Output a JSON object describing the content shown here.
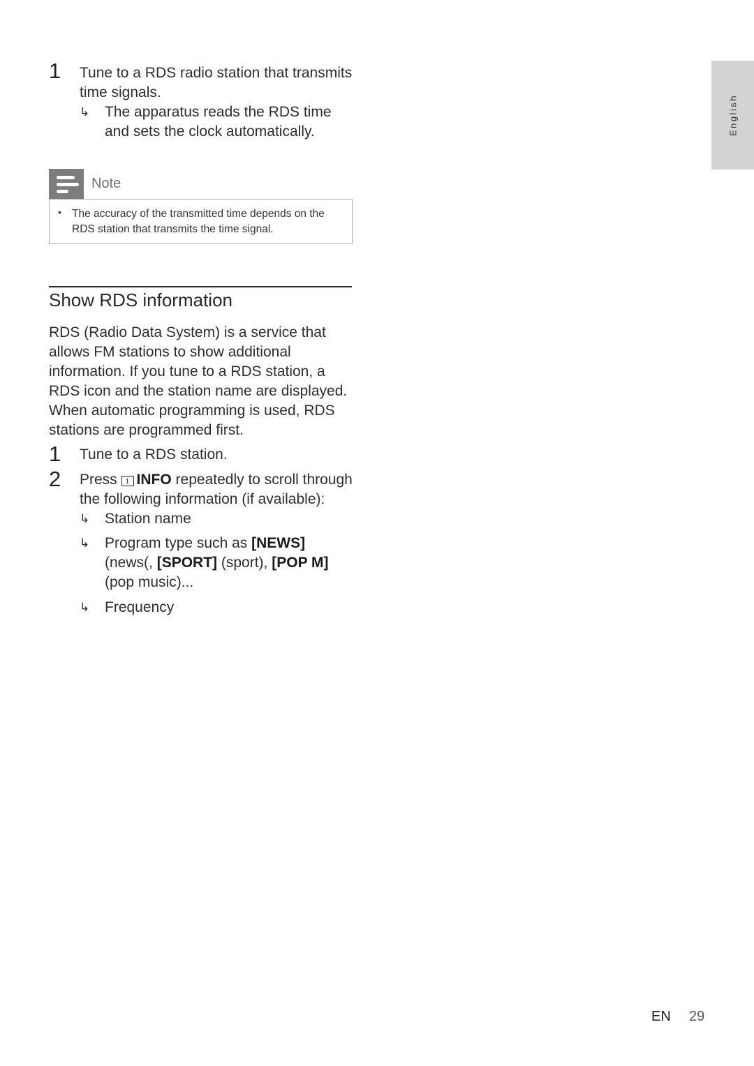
{
  "side_tab": {
    "language": "English"
  },
  "section1": {
    "step1": {
      "number": "1",
      "text": "Tune to a RDS radio station that transmits time signals.",
      "result": "The apparatus reads the RDS time and sets the clock automatically."
    }
  },
  "note": {
    "icon": "note-lines-icon",
    "label": "Note",
    "bullets": [
      "The accuracy of the transmitted time depends on the RDS station that transmits the time signal."
    ]
  },
  "section2": {
    "heading": "Show RDS information",
    "intro": "RDS (Radio Data System) is a service that allows FM stations to show additional information. If you tune to a RDS station, a RDS icon and the station name are displayed. When automatic programming is used, RDS stations are programmed first.",
    "steps": [
      {
        "number": "1",
        "text": "Tune to a RDS station."
      },
      {
        "number": "2",
        "text_before": "Press",
        "button_icon": "info-icon",
        "button_label": "INFO",
        "text_after": "repeatedly to scroll through the following information (if available):",
        "results": [
          {
            "text": "Station name"
          },
          {
            "prefix": "Program type such as",
            "code1": "[NEWS]",
            "mid1": "(news(,",
            "code2": "[SPORT]",
            "mid2": "(sport),",
            "code3": "[POP M]",
            "suffix": "(pop music)..."
          },
          {
            "text": "Frequency"
          }
        ]
      }
    ]
  },
  "footer": {
    "lang_code": "EN",
    "page_number": "29"
  },
  "symbols": {
    "result_arrow": "↳"
  }
}
